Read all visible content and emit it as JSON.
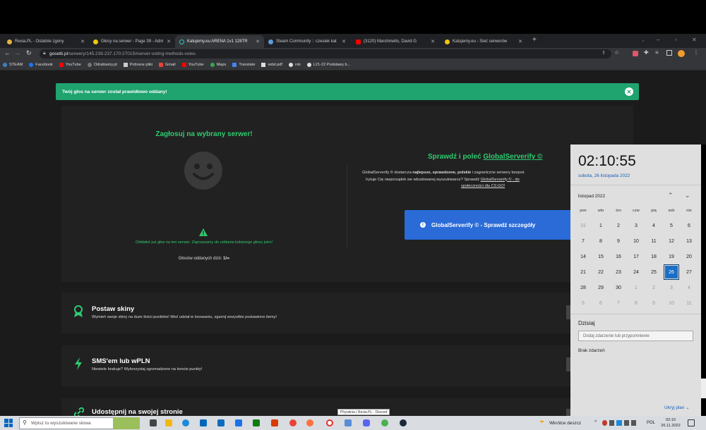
{
  "browser": {
    "tabs": [
      {
        "label": "Rexia.PL - Ostatnie zgony",
        "color": "#e3b341"
      },
      {
        "label": "Głosy na serwer - Page 39 - Adm",
        "color": "#f1c40f"
      },
      {
        "label": "Katujemy.eu ARENA 1v1 128TR",
        "color": "#1fd1c1"
      },
      {
        "label": "Steam Community :: czesiek kat",
        "color": "#5d9bd8"
      },
      {
        "label": "(3120) Marshmello, David G",
        "color": "#ff0000"
      },
      {
        "label": "Katujemy.eu - Sieć serwerów",
        "color": "#f1c40f"
      }
    ],
    "new_tab": "+",
    "url_host": "gosetti.pl",
    "url_path": "/serwery/145.239.237.170:27015#server-voting-methods-votes",
    "bookmarks": [
      {
        "label": "STEAM",
        "color": "#3b82c4"
      },
      {
        "label": "Facebook",
        "color": "#1877f2"
      },
      {
        "label": "YouTube",
        "color": "#ff0000"
      },
      {
        "label": "Odrabiamy.pl",
        "color": "#777777"
      },
      {
        "label": "Pobrane pliki",
        "color": "#cccccc"
      },
      {
        "label": "Gmail",
        "color": "#ea4335"
      },
      {
        "label": "YouTube",
        "color": "#ff0000"
      },
      {
        "label": "Maps",
        "color": "#34a853"
      },
      {
        "label": "Translate",
        "color": "#4285f4"
      },
      {
        "label": "wdsl.pdf",
        "color": "#dddddd"
      },
      {
        "label": "rok",
        "color": "#dddddd"
      },
      {
        "label": "L21-22 Podstawy b...",
        "color": "#dddddd"
      }
    ]
  },
  "alert": {
    "text": "Twój głos na serwer został prawidłowo oddany!"
  },
  "vote": {
    "title": "Zagłosuj na wybrany serwer!",
    "notice": "Oddałeś już głos na ten serwer. Zapraszamy do oddania kolejnego głosu jutro!",
    "count_label": "Głosów oddanych dziś:",
    "count_value": "1/∞"
  },
  "promo": {
    "title_prefix": "Sprawdź i poleć",
    "title_link": "GlobalServerify ©",
    "desc1_a": "GlobalServerify © dostarcza",
    "desc1_b": "najlepsze, sprawdzone, polskie",
    "desc1_c": "i zagraniczne serwery bezpoś",
    "desc2_a": "Irytuje Cię nieporządek we wbudowanej wyszukiwarce? Sprawdź",
    "desc2_link": "GlobalServerify © - do",
    "desc3": "społeczności dla CS:GO!",
    "button": "GlobalServerify © - Sprawdź szczegóły"
  },
  "features": [
    {
      "title": "Postaw skiny",
      "desc": "Wymień swoje skiny na duże ilości punktów! Weź udział w losowaniu, zgarnij wszystkie postawione itemy!"
    },
    {
      "title": "SMS'em lub wPLN",
      "desc": "Niewiele brakuje? Wykorzystaj zgromadzone na koncie punkty!"
    },
    {
      "title": "Udostępnij na swojej stronie",
      "desc": ""
    }
  ],
  "calendar": {
    "time": "02:10:55",
    "date": "sobota, 26 listopada 2022",
    "month": "listopad 2022",
    "dows": [
      "pon",
      "wto",
      "śro",
      "czw",
      "pią",
      "sob",
      "nie"
    ],
    "weeks": [
      [
        "31",
        "1",
        "2",
        "3",
        "4",
        "5",
        "6"
      ],
      [
        "7",
        "8",
        "9",
        "10",
        "11",
        "12",
        "13"
      ],
      [
        "14",
        "15",
        "16",
        "17",
        "18",
        "19",
        "20"
      ],
      [
        "21",
        "22",
        "23",
        "24",
        "25",
        "26",
        "27"
      ],
      [
        "28",
        "29",
        "30",
        "1",
        "2",
        "3",
        "4"
      ],
      [
        "5",
        "6",
        "7",
        "8",
        "9",
        "10",
        "11"
      ]
    ],
    "today_label": "Dzisiaj",
    "event_placeholder": "Dodaj zdarzenie lub przypomnienie",
    "no_events": "Brak zdarzeń",
    "hide_plan": "Ukryj plan"
  },
  "taskbar": {
    "search_placeholder": "Wpisz tu wyszukiwane słowa",
    "tooltip": "Phyralnia | Rexia.PL - Discord",
    "weather": "Wkrótce deszcz",
    "lang": "POL",
    "time": "02:10",
    "date": "26.11.2022"
  }
}
